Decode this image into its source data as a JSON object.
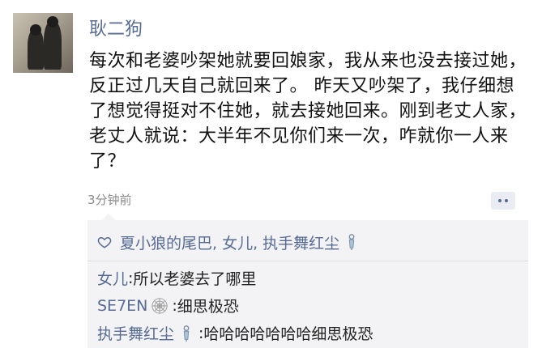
{
  "post": {
    "username": "耿二狗",
    "content": "每次和老婆吵架她就要回娘家，我从来也没去接过她，反正过几天自己就回来了。 昨天又吵架了，我仔细想了想觉得挺对不住她，就去接她回来。刚到老丈人家，老丈人就说：大半年不见你们来一次，咋就你一人来了？",
    "time": "3分钟前"
  },
  "likes": {
    "names": "夏小狼的尾巴, 女儿, 执手舞红尘"
  },
  "comments": [
    {
      "author": "女儿",
      "separator": ": ",
      "text": "所以老婆去了哪里"
    },
    {
      "author": "SE7EN",
      "separator": ": ",
      "text": "细思极恐"
    },
    {
      "author": "执手舞红尘",
      "separator": ": ",
      "text": "哈哈哈哈哈哈哈细思极恐"
    }
  ],
  "icons": {
    "like": "heart-outline-icon",
    "comment_button": "comment-dots-icon",
    "badge_spider": "spiderweb-badge-icon",
    "badge_bell": "windbell-badge-icon"
  },
  "colors": {
    "link": "#576b95",
    "panel_bg": "#f3f3f5",
    "text": "#111111",
    "time": "#8a8a8a"
  }
}
